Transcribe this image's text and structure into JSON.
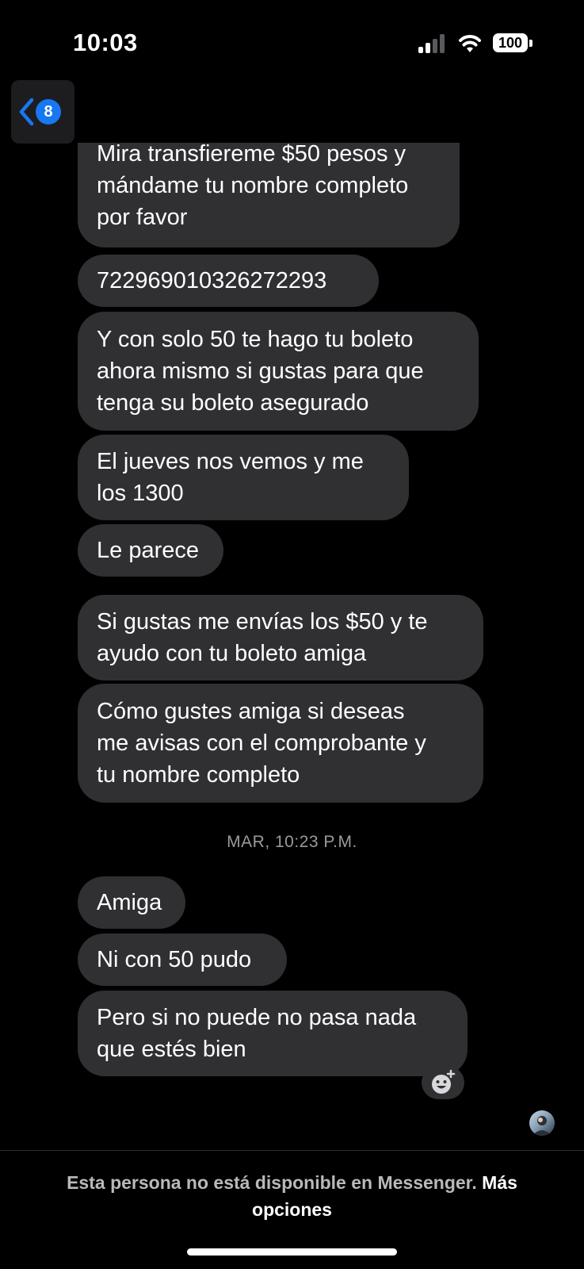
{
  "status_bar": {
    "time": "10:03",
    "battery": "100"
  },
  "header": {
    "back_badge_count": "8"
  },
  "messages": [
    "Mira transfiereme $50 pesos y\nmándame tu nombre completo\npor favor",
    "722969010326272293",
    "Y con solo 50 te hago tu boleto\nahora mismo si gustas para que\ntenga su boleto asegurado",
    "El jueves nos vemos y me\nlos 1300",
    "Le parece",
    "Si gustas me envías los $50 y te\nayudo con tu boleto amiga",
    "Cómo gustes amiga si deseas\nme avisas con el comprobante y\ntu nombre completo",
    "Amiga",
    "Ni con 50 pudo",
    "Pero si no puede no pasa nada\nque estés bien"
  ],
  "timestamp": "MAR, 10:23 P.M.",
  "footer": {
    "notice": "Esta persona no está disponible en Messenger.",
    "link": "Más opciones"
  },
  "colors": {
    "background": "#000000",
    "bubble": "#303033",
    "badge": "#1877f2",
    "chevron": "#1877f2",
    "muted_text": "#9a9a9e"
  }
}
